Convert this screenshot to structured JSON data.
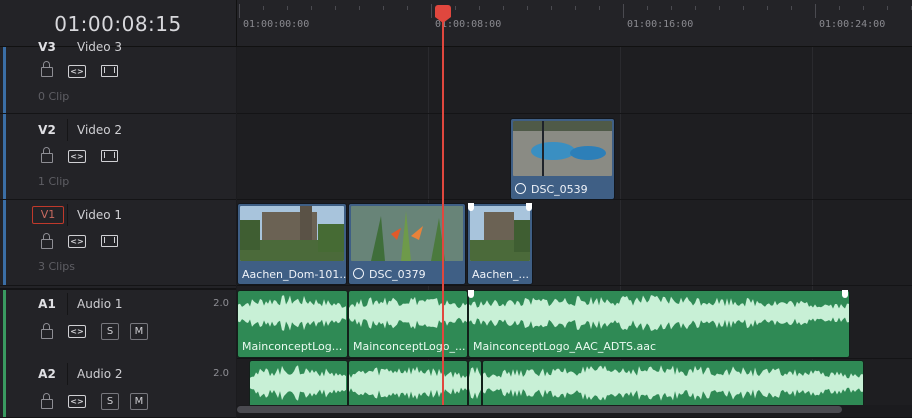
{
  "timecode": "01:00:08:15",
  "ruler": {
    "labels": [
      "01:00:00:00",
      "01:00:08:00",
      "01:00:16:00",
      "01:00:24:00"
    ]
  },
  "tracks": {
    "v3": {
      "id": "V3",
      "name": "Video 3",
      "clips": "0 Clip"
    },
    "v2": {
      "id": "V2",
      "name": "Video 2",
      "clips": "1 Clip"
    },
    "v1": {
      "id": "V1",
      "name": "Video 1",
      "clips": "3 Clips"
    },
    "a1": {
      "id": "A1",
      "name": "Audio 1",
      "gain": "2.0",
      "solo": "S",
      "mute": "M"
    },
    "a2": {
      "id": "A2",
      "name": "Audio 2",
      "gain": "2.0",
      "solo": "S",
      "mute": "M"
    }
  },
  "clips": {
    "v2_dsc0539": "DSC_0539",
    "v1_aachen1": "Aachen_Dom-101...",
    "v1_dsc0379": "DSC_0379",
    "v1_aachen2": "Aachen_...",
    "a1_logo1": "MainconceptLog...",
    "a1_logo2": "MainconceptLogo_...",
    "a1_logo3": "MainconceptLogo_AAC_ADTS.aac"
  },
  "icons": {
    "lock": "lock-icon",
    "link": "link-icon",
    "film": "film-icon",
    "speed": "speed-icon"
  },
  "colors": {
    "playhead": "#e0473e",
    "video_clip": "#3f5f85",
    "audio_clip": "#2f8a55",
    "video_strip": "#3b6ea5",
    "audio_strip": "#3a9a60"
  }
}
